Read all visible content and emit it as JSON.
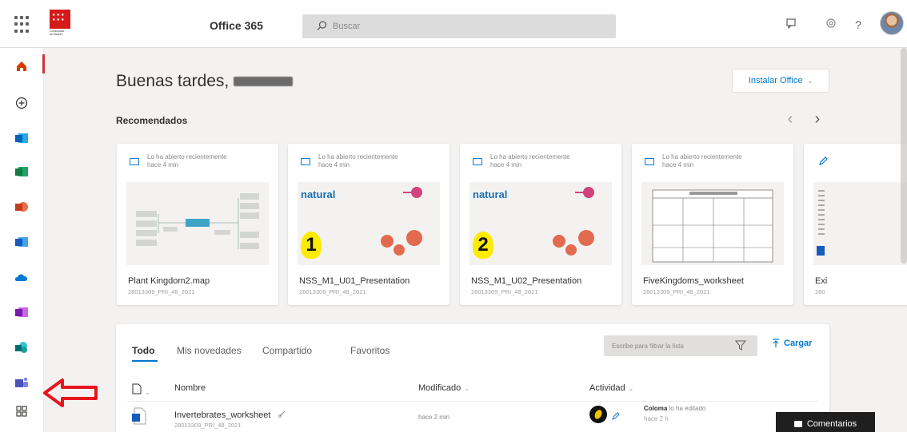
{
  "header": {
    "app_title": "Office 365",
    "search_placeholder": "Buscar",
    "icons": [
      "waffle-icon",
      "community-madrid-logo",
      "feedback-icon",
      "settings-icon",
      "help-icon",
      "avatar"
    ],
    "help_glyph": "?"
  },
  "rail": {
    "items": [
      "home-icon",
      "create-icon",
      "outlook-icon",
      "excel-icon",
      "powerpoint-icon",
      "word-icon",
      "onedrive-icon",
      "onenote-icon",
      "sharepoint-icon",
      "teams-icon",
      "all-apps-icon"
    ],
    "accent": "#d13438"
  },
  "main": {
    "greeting": "Buenas tardes,",
    "install_label": "Instalar Office",
    "recommended_title": "Recomendados",
    "cards": [
      {
        "line1": "Lo ha abierto recientemente",
        "line2": "hace 4 min",
        "name": "Plant Kingdom2.map",
        "location": "28013309_PRI_48_2021"
      },
      {
        "line1": "Lo ha abierto recientemente",
        "line2": "hace 4 min",
        "name": "NSS_M1_U01_Presentation",
        "location": "28013309_PRI_48_2021",
        "brand": "natural",
        "number": "1"
      },
      {
        "line1": "Lo ha abierto recientemente",
        "line2": "hace 4 min",
        "name": "NSS_M1_U02_Presentation",
        "location": "28013309_PRI_48_2021",
        "brand": "natural",
        "number": "2"
      },
      {
        "line1": "Lo ha abierto recientemente",
        "line2": "hace 4 min",
        "name": "FiveKingdoms_worksheet",
        "location": "28013309_PRI_48_2021"
      },
      {
        "name": "Exi",
        "location": "280"
      }
    ]
  },
  "files": {
    "tabs": [
      "Todo",
      "Mis novedades",
      "Compartido",
      "Favoritos"
    ],
    "filter_placeholder": "Escribe para filtrar la lista",
    "upload_label": "Cargar",
    "columns": {
      "name": "Nombre",
      "modified": "Modificado",
      "activity": "Actividad"
    },
    "rows": [
      {
        "name": "Invertebrates_worksheet",
        "location": "28013309_PRI_48_2021",
        "modified": "hace 2 min",
        "user": "Coloma",
        "action": "lo ha editado",
        "time": "hace 2 h"
      }
    ]
  },
  "comments_label": "Comentarios",
  "colors": {
    "accent_blue": "#0078d4",
    "brand_red": "#d41a1a",
    "arrow_red": "#e8141c"
  }
}
